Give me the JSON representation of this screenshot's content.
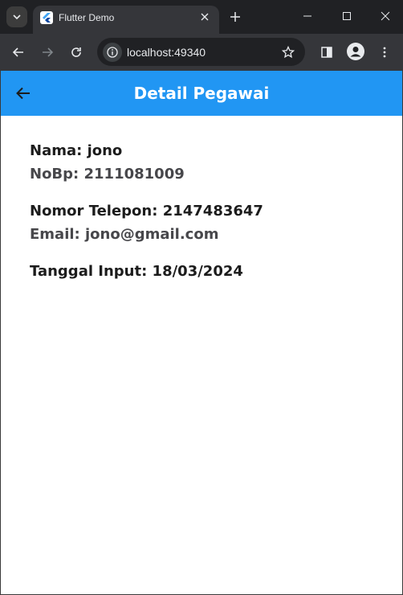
{
  "browser": {
    "tab_title": "Flutter Demo",
    "url": "localhost:49340"
  },
  "app": {
    "title": "Detail Pegawai"
  },
  "detail": {
    "nama": "Nama: jono",
    "nobp": "NoBp: 2111081009",
    "telepon": "Nomor Telepon: 2147483647",
    "email": "Email: jono@gmail.com",
    "tanggal": "Tanggal Input: 18/03/2024"
  },
  "colors": {
    "appbar": "#2196f3",
    "browser_frame": "#202124",
    "toolbar": "#35363a",
    "primary_text": "#1c1c1c",
    "secondary_text": "#47474b"
  },
  "icons": [
    "tab-search-icon",
    "flutter-icon",
    "close-icon",
    "plus-icon",
    "minimize-icon",
    "maximize-icon",
    "window-close-icon",
    "back-icon",
    "forward-icon",
    "reload-icon",
    "info-icon",
    "star-icon",
    "sidepanel-icon",
    "profile-icon",
    "menu-dots-icon",
    "arrow-back-icon"
  ]
}
